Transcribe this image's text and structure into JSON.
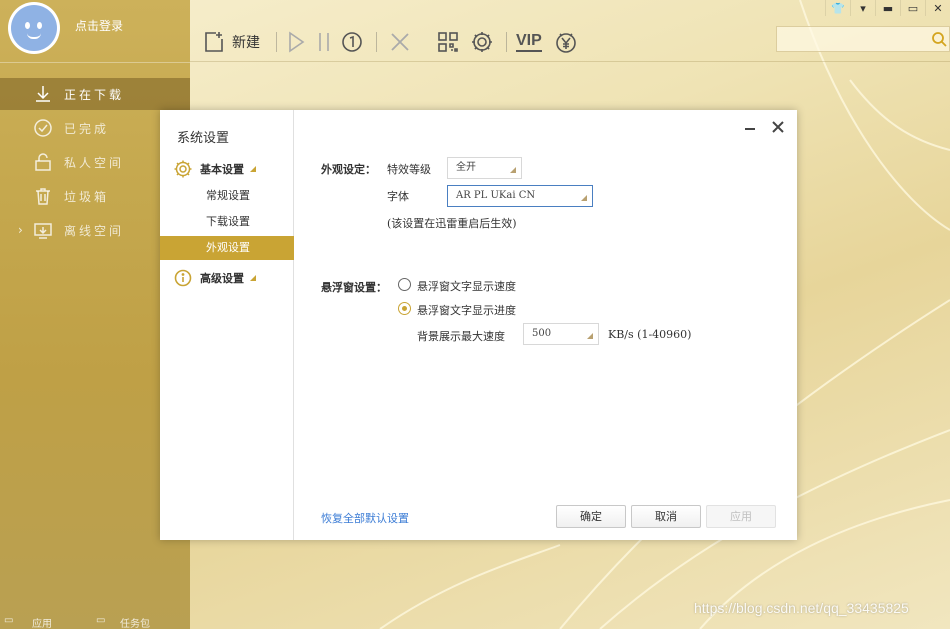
{
  "sidebar": {
    "login_text": "点击登录",
    "items": [
      {
        "label": "正在下载",
        "icon": "download-icon",
        "active": true
      },
      {
        "label": "已完成",
        "icon": "check-circle-icon",
        "active": false
      },
      {
        "label": "私人空间",
        "icon": "lock-icon",
        "active": false
      },
      {
        "label": "垃圾箱",
        "icon": "trash-icon",
        "active": false
      },
      {
        "label": "离线空间",
        "icon": "cloud-download-icon",
        "active": false,
        "expandable": true
      }
    ],
    "bottom_items": [
      "应用",
      "任务包"
    ]
  },
  "toolbar": {
    "new_label": "新建",
    "icons": [
      "new-task-icon",
      "play-icon",
      "pause-icon",
      "limit-speed-icon",
      "delete-icon",
      "qr-code-icon",
      "settings-gear-icon",
      "vip-icon",
      "money-icon"
    ],
    "vip_text": "VIP"
  },
  "search": {
    "placeholder": ""
  },
  "dialog": {
    "title": "系统设置",
    "categories": [
      {
        "label": "基本设置",
        "icon": "gear-icon",
        "subitems": [
          "常规设置",
          "下载设置",
          "外观设置"
        ],
        "active_sub": "外观设置"
      },
      {
        "label": "高级设置",
        "icon": "info-icon",
        "subitems": []
      }
    ],
    "appearance": {
      "section_label": "外观设定：",
      "effect_label": "特效等级",
      "effect_value": "全开",
      "font_label": "字体",
      "font_value": "AR PL UKai CN",
      "note": "(该设置在迅雷重启后生效)"
    },
    "floating": {
      "section_label": "悬浮窗设置：",
      "options": [
        {
          "label": "悬浮窗文字显示速度",
          "checked": false
        },
        {
          "label": "悬浮窗文字显示进度",
          "checked": true
        }
      ],
      "max_speed_label": "背景展示最大速度",
      "max_speed_value": "500",
      "unit_label": "KB/s (1-40960)"
    },
    "restore_label": "恢复全部默认设置",
    "ok_label": "确定",
    "cancel_label": "取消",
    "apply_label": "应用"
  },
  "watermark": "https://blog.csdn.net/qq_33435825",
  "colors": {
    "accent": "#c9a434",
    "link": "#3a7bd5",
    "focus_border": "#4a7fc1"
  }
}
